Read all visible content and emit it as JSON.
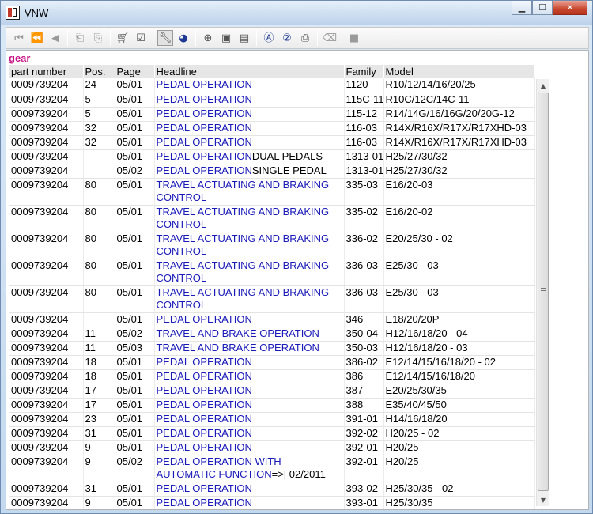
{
  "window": {
    "title": "VNW",
    "minimize_glyph": "▁",
    "maximize_glyph": "☐",
    "close_glyph": "✕"
  },
  "toolbar": {
    "groups": [
      [
        "first-record-icon",
        "prev-page-icon",
        "prev-record-icon"
      ],
      [
        "doc-back-icon",
        "doc-forward-icon"
      ],
      [
        "cart-icon",
        "checklist-icon"
      ],
      [
        "wrench-icon",
        "globe-icon"
      ],
      [
        "zoom-in-icon",
        "page-icon",
        "page-alt-icon"
      ],
      [
        "search-a-icon",
        "search-2-icon",
        "print-icon"
      ],
      [
        "eraser-icon"
      ],
      [
        "stop-icon"
      ]
    ]
  },
  "search": {
    "term": "gear"
  },
  "table": {
    "columns": [
      "part number",
      "Pos.",
      "Page",
      "Headline",
      "Family",
      "Model"
    ],
    "rows": [
      {
        "part": "0009739204",
        "pos": "24",
        "page": "05/01",
        "headline": "PEDAL OPERATION",
        "suffix": "",
        "family": "1120",
        "model": "R10/12/14/16/20/25"
      },
      {
        "part": "0009739204",
        "pos": "5",
        "page": "05/01",
        "headline": "PEDAL OPERATION",
        "suffix": "",
        "family": "115C-11",
        "model": "R10C/12C/14C-11"
      },
      {
        "part": "0009739204",
        "pos": "5",
        "page": "05/01",
        "headline": "PEDAL OPERATION",
        "suffix": "",
        "family": "115-12",
        "model": "R14/14G/16/16G/20/20G-12"
      },
      {
        "part": "0009739204",
        "pos": "32",
        "page": "05/01",
        "headline": "PEDAL OPERATION",
        "suffix": "",
        "family": "116-03",
        "model": "R14X/R16X/R17X/R17XHD-03"
      },
      {
        "part": "0009739204",
        "pos": "32",
        "page": "05/01",
        "headline": "PEDAL OPERATION",
        "suffix": "",
        "family": "116-03",
        "model": "R14X/R16X/R17X/R17XHD-03"
      },
      {
        "part": "0009739204",
        "pos": "",
        "page": "05/01",
        "headline": "PEDAL OPERATION",
        "suffix": "DUAL PEDALS",
        "family": "1313-01",
        "model": "H25/27/30/32"
      },
      {
        "part": "0009739204",
        "pos": "",
        "page": "05/02",
        "headline": "PEDAL OPERATION",
        "suffix": "SINGLE PEDAL",
        "family": "1313-01",
        "model": "H25/27/30/32"
      },
      {
        "part": "0009739204",
        "pos": "80",
        "page": "05/01",
        "headline": "TRAVEL ACTUATING AND BRAKING CONTROL",
        "suffix": "",
        "family": "335-03",
        "model": "E16/20-03",
        "two_line": true
      },
      {
        "part": "0009739204",
        "pos": "80",
        "page": "05/01",
        "headline": "TRAVEL ACTUATING AND BRAKING CONTROL",
        "suffix": "",
        "family": "335-02",
        "model": "E16/20-02",
        "two_line": true
      },
      {
        "part": "0009739204",
        "pos": "80",
        "page": "05/01",
        "headline": "TRAVEL ACTUATING AND BRAKING CONTROL",
        "suffix": "",
        "family": "336-02",
        "model": "E20/25/30 - 02",
        "two_line": true
      },
      {
        "part": "0009739204",
        "pos": "80",
        "page": "05/01",
        "headline": "TRAVEL ACTUATING AND BRAKING CONTROL",
        "suffix": "",
        "family": "336-03",
        "model": "E25/30 - 03",
        "two_line": true
      },
      {
        "part": "0009739204",
        "pos": "80",
        "page": "05/01",
        "headline": "TRAVEL ACTUATING AND BRAKING CONTROL",
        "suffix": "",
        "family": "336-03",
        "model": "E25/30 - 03",
        "two_line": true
      },
      {
        "part": "0009739204",
        "pos": "",
        "page": "05/01",
        "headline": "PEDAL OPERATION",
        "suffix": "",
        "family": "346",
        "model": "E18/20/20P"
      },
      {
        "part": "0009739204",
        "pos": "11",
        "page": "05/02",
        "headline": "TRAVEL AND BRAKE OPERATION",
        "suffix": "",
        "family": "350-04",
        "model": "H12/16/18/20 - 04"
      },
      {
        "part": "0009739204",
        "pos": "11",
        "page": "05/03",
        "headline": "TRAVEL AND BRAKE OPERATION",
        "suffix": "",
        "family": "350-03",
        "model": "H12/16/18/20 - 03"
      },
      {
        "part": "0009739204",
        "pos": "18",
        "page": "05/01",
        "headline": "PEDAL OPERATION",
        "suffix": "",
        "family": "386-02",
        "model": "E12/14/15/16/18/20 - 02"
      },
      {
        "part": "0009739204",
        "pos": "18",
        "page": "05/01",
        "headline": "PEDAL OPERATION",
        "suffix": "",
        "family": "386",
        "model": "E12/14/15/16/18/20"
      },
      {
        "part": "0009739204",
        "pos": "17",
        "page": "05/01",
        "headline": "PEDAL OPERATION",
        "suffix": "",
        "family": "387",
        "model": "E20/25/30/35"
      },
      {
        "part": "0009739204",
        "pos": "17",
        "page": "05/01",
        "headline": "PEDAL OPERATION",
        "suffix": "",
        "family": "388",
        "model": "E35/40/45/50"
      },
      {
        "part": "0009739204",
        "pos": "23",
        "page": "05/01",
        "headline": "PEDAL OPERATION",
        "suffix": "",
        "family": "391-01",
        "model": "H14/16/18/20"
      },
      {
        "part": "0009739204",
        "pos": "31",
        "page": "05/01",
        "headline": "PEDAL OPERATION",
        "suffix": "",
        "family": "392-02",
        "model": "H20/25 - 02"
      },
      {
        "part": "0009739204",
        "pos": "9",
        "page": "05/01",
        "headline": "PEDAL OPERATION",
        "suffix": "",
        "family": "392-01",
        "model": "H20/25"
      },
      {
        "part": "0009739204",
        "pos": "9",
        "page": "05/02",
        "headline": "PEDAL OPERATION WITH AUTOMATIC FUNCTION",
        "suffix": "=>| 02/2011",
        "family": "392-01",
        "model": "H20/25",
        "two_line": true
      },
      {
        "part": "0009739204",
        "pos": "31",
        "page": "05/01",
        "headline": "PEDAL OPERATION",
        "suffix": "",
        "family": "393-02",
        "model": "H25/30/35 - 02"
      },
      {
        "part": "0009739204",
        "pos": "9",
        "page": "05/01",
        "headline": "PEDAL OPERATION",
        "suffix": "",
        "family": "393-01",
        "model": "H25/30/35"
      }
    ]
  },
  "scrollbar": {
    "up_glyph": "▲",
    "down_glyph": "▼"
  },
  "colors": {
    "headline_text": "#1a1ab8",
    "search_term": "#c71585"
  }
}
